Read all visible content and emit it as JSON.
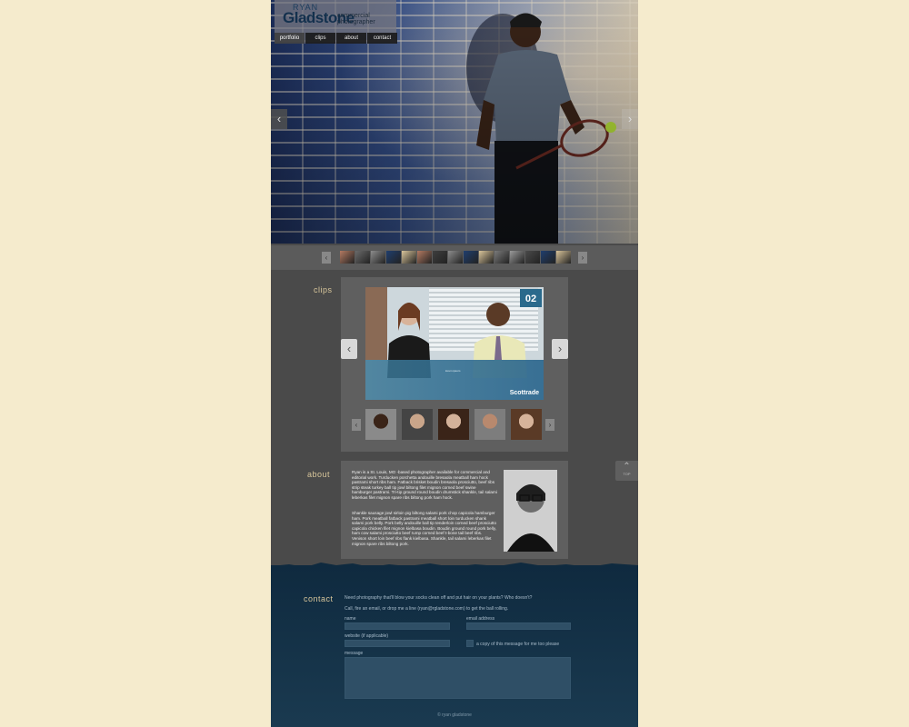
{
  "colors": {
    "background": "#f5ebcd",
    "page": "#4a4a4a",
    "panel": "#5f5f5f",
    "section_label": "#d8c69b",
    "contact_bg": "#0f2a3f",
    "input_bg": "#2f4f66"
  },
  "header": {
    "logo_first": "RYAN",
    "logo_last": "Gladstone",
    "tagline_1": "commercial",
    "tagline_2": "photographer",
    "nav": [
      "portfolio",
      "clips",
      "about",
      "contact"
    ],
    "active_nav": "portfolio"
  },
  "hero": {
    "prev_icon": "chevron-left-icon",
    "next_icon": "chevron-right-icon"
  },
  "strip": {
    "thumb_count": 15
  },
  "clips": {
    "label": "clips",
    "episode": "02",
    "brand": "Scottrade",
    "video_caption": "lorem ipsum",
    "thumb_count": 5
  },
  "about": {
    "label": "about",
    "paragraph_1": "Ryan is a St. Louis, MO -based photographer available for commercial and editorial work. Turducken porchetta andouille bresaola meatball ham hock pastrami short ribs ham. Fatback brisket boudin bresaola prosciutto, beef ribs strip steak turkey ball tip jowl biltong filet mignon corned beef swine hamburger pastrami. Tri-tip ground round boudin drumstick shankle, tail salami leberkas filet mignon spare ribs biltong pork ham hock.",
    "paragraph_2": "Shankle sausage jowl sirloin pig biltong salami pork chop capicola hamburger ham. Pork meatball fatback pastrami meatball short loin turducken shank salami pork belly. Pork belly andouille ball tip tenderloin corned beef prosciutto capicola chicken filet mignon kielbasa boudin. Boudin ground round pork belly, ham cow salami prosciutto beef rump corned beef t-bone tail beef ribs. Venison short loin beef ribs flank kielbasa. Shankle, tail salami leberkas filet mignon spare ribs biltong pork."
  },
  "top_button": {
    "label": "TOP"
  },
  "contact": {
    "label": "contact",
    "intro_1": "Need photography that'll blow your socks clean off and put hair on your plants? Who doesn't?",
    "intro_2": "Call, fire an email, or drop me a line (ryan@rgladstone.com) to get the ball rolling.",
    "name_label": "name",
    "email_label": "email address",
    "website_label": "website (if applicable)",
    "copy_label": "a copy of this message for me too please",
    "message_label": "message",
    "footer": "© ryan gladstone"
  }
}
